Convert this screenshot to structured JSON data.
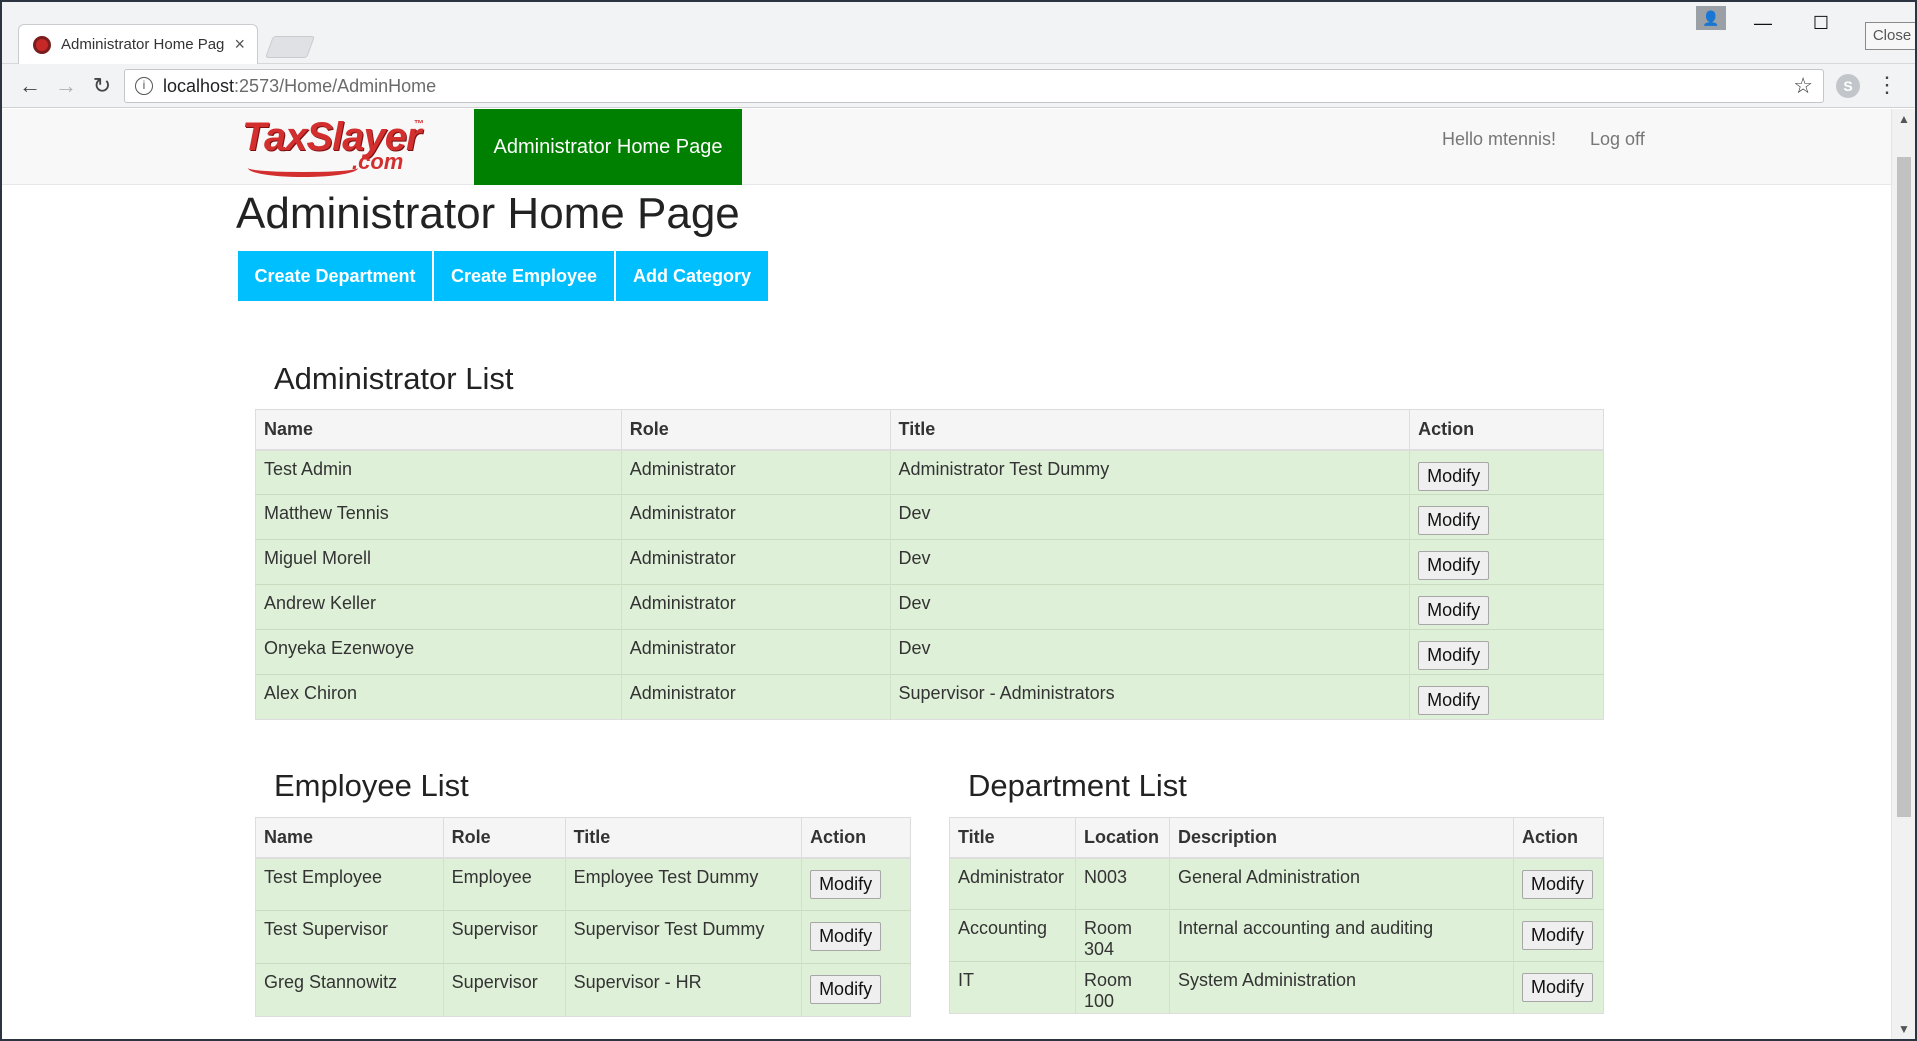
{
  "browser": {
    "tab_title": "Administrator Home Pag",
    "tab_close": "×",
    "url_host": "localhost",
    "url_rest": ":2573/Home/AdminHome",
    "close_tooltip": "Close"
  },
  "icons": {
    "back": "←",
    "forward": "→",
    "reload": "↻",
    "info": "i",
    "star": "☆",
    "menu": "⋮",
    "minimize": "—",
    "maximize": "☐",
    "profile": "👤",
    "ext": "S",
    "scroll_up": "▲",
    "scroll_down": "▼"
  },
  "navbar": {
    "logo_main": "TaxSlayer",
    "logo_tm": "™",
    "logo_com": ".com",
    "active_link": "Administrator Home Page",
    "hello": "Hello mtennis!",
    "logoff": "Log off"
  },
  "page": {
    "title": "Administrator Home Page",
    "buttons": {
      "create_department": "Create Department",
      "create_employee": "Create Employee",
      "add_category": "Add Category"
    }
  },
  "admin_list": {
    "title": "Administrator List",
    "headers": [
      "Name",
      "Role",
      "Title",
      "Action"
    ],
    "rows": [
      [
        "Test Admin",
        "Administrator",
        "Administrator Test Dummy",
        "Modify"
      ],
      [
        "Matthew Tennis",
        "Administrator",
        "Dev",
        "Modify"
      ],
      [
        "Miguel Morell",
        "Administrator",
        "Dev",
        "Modify"
      ],
      [
        "Andrew Keller",
        "Administrator",
        "Dev",
        "Modify"
      ],
      [
        "Onyeka Ezenwoye",
        "Administrator",
        "Dev",
        "Modify"
      ],
      [
        "Alex Chiron",
        "Administrator",
        "Supervisor - Administrators",
        "Modify"
      ]
    ]
  },
  "employee_list": {
    "title": "Employee List",
    "headers": [
      "Name",
      "Role",
      "Title",
      "Action"
    ],
    "rows": [
      [
        "Test Employee",
        "Employee",
        "Employee Test Dummy",
        "Modify"
      ],
      [
        "Test Supervisor",
        "Supervisor",
        "Supervisor Test Dummy",
        "Modify"
      ],
      [
        "Greg Stannowitz",
        "Supervisor",
        "Supervisor - HR",
        "Modify"
      ]
    ]
  },
  "department_list": {
    "title": "Department List",
    "headers": [
      "Title",
      "Location",
      "Description",
      "Action"
    ],
    "rows": [
      [
        "Administrator",
        "N003",
        "General Administration",
        "Modify"
      ],
      [
        "Accounting",
        "Room 304",
        "Internal accounting and auditing",
        "Modify"
      ],
      [
        "IT",
        "Room 100",
        "System Administration",
        "Modify"
      ]
    ]
  }
}
